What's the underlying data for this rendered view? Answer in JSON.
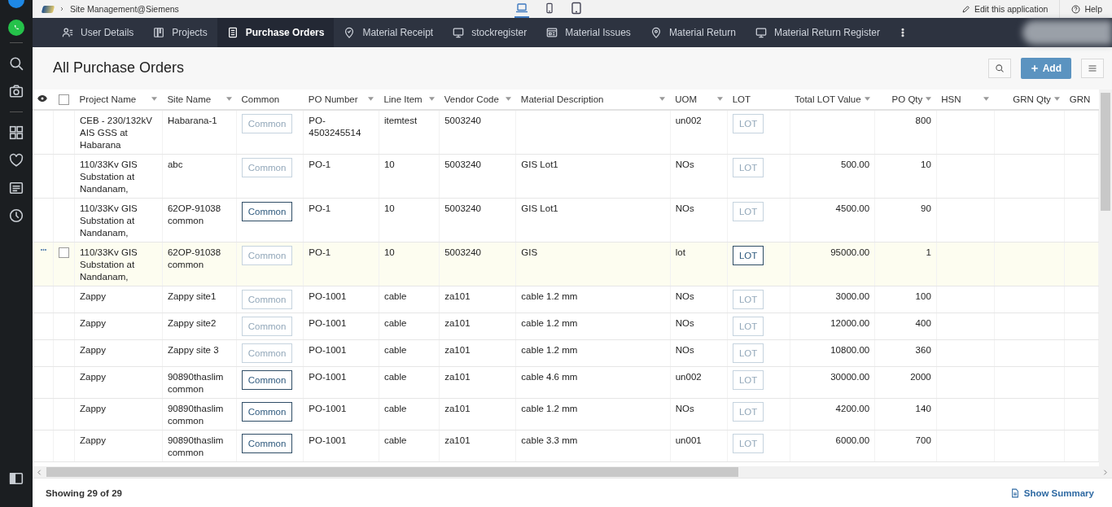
{
  "topbar": {
    "breadcrumb": "Site Management@Siemens",
    "devices": [
      {
        "kind": "laptop",
        "selected": true
      },
      {
        "kind": "phone",
        "selected": false
      },
      {
        "kind": "tablet",
        "selected": false
      }
    ],
    "edit_link": "Edit this application",
    "help_link": "Help"
  },
  "nav": {
    "tabs": [
      {
        "label": "User Details",
        "kind": "users",
        "selected": false
      },
      {
        "label": "Projects",
        "kind": "board",
        "selected": false
      },
      {
        "label": "Purchase Orders",
        "kind": "list",
        "selected": true
      },
      {
        "label": "Material Receipt",
        "kind": "pin-check",
        "selected": false
      },
      {
        "label": "stockregister",
        "kind": "monitor",
        "selected": false
      },
      {
        "label": "Material Issues",
        "kind": "form",
        "selected": false
      },
      {
        "label": "Material Return",
        "kind": "pin",
        "selected": false
      },
      {
        "label": "Material Return Register",
        "kind": "monitor",
        "selected": false
      }
    ]
  },
  "page": {
    "title": "All Purchase Orders",
    "add_button": "Add"
  },
  "table": {
    "select_all_checked": false,
    "columns": [
      {
        "label": "Project Name",
        "kind": "text",
        "sortable": true
      },
      {
        "label": "Site Name",
        "kind": "text",
        "sortable": true
      },
      {
        "label": "Common",
        "kind": "button",
        "sortable": false
      },
      {
        "label": "PO Number",
        "kind": "text",
        "sortable": true
      },
      {
        "label": "Line Item",
        "kind": "text",
        "sortable": true
      },
      {
        "label": "Vendor Code",
        "kind": "text",
        "sortable": true
      },
      {
        "label": "Material Description",
        "kind": "text",
        "sortable": true
      },
      {
        "label": "UOM",
        "kind": "text",
        "sortable": true
      },
      {
        "label": "LOT",
        "kind": "button",
        "sortable": false
      },
      {
        "label": "Total LOT Value",
        "kind": "number",
        "sortable": true
      },
      {
        "label": "PO Qty",
        "kind": "number",
        "sortable": true
      },
      {
        "label": "HSN",
        "kind": "text",
        "sortable": true
      },
      {
        "label": "GRN Qty",
        "kind": "number",
        "sortable": true
      },
      {
        "label": "GRN",
        "kind": "text",
        "sortable": false
      }
    ],
    "rows": [
      {
        "highlighted": false,
        "cells": [
          "CEB - 230/132kV AIS GSS at Habarana",
          "Habarana-1",
          {
            "label": "Common",
            "disabled": true
          },
          "PO-4503245514",
          "itemtest",
          "5003240",
          null,
          "un002",
          {
            "label": "LOT",
            "disabled": true
          },
          null,
          "800",
          null,
          null,
          null
        ]
      },
      {
        "highlighted": false,
        "cells": [
          "110/33Kv GIS Substation at Nandanam,",
          "abc",
          {
            "label": "Common",
            "disabled": true
          },
          "PO-1",
          "10",
          "5003240",
          "GIS Lot1",
          "NOs",
          {
            "label": "LOT",
            "disabled": true
          },
          "500.00",
          "10",
          null,
          null,
          null
        ]
      },
      {
        "highlighted": false,
        "cells": [
          "110/33Kv GIS Substation at Nandanam,",
          "62OP-91038 common",
          {
            "label": "Common",
            "disabled": false
          },
          "PO-1",
          "10",
          "5003240",
          "GIS Lot1",
          "NOs",
          {
            "label": "LOT",
            "disabled": true
          },
          "4500.00",
          "90",
          null,
          null,
          null
        ]
      },
      {
        "highlighted": true,
        "cells": [
          "110/33Kv GIS Substation at Nandanam,",
          "62OP-91038 common",
          {
            "label": "Common",
            "disabled": true
          },
          "PO-1",
          "10",
          "5003240",
          "GIS",
          "lot",
          {
            "label": "LOT",
            "disabled": false
          },
          "95000.00",
          "1",
          null,
          null,
          null
        ]
      },
      {
        "highlighted": false,
        "cells": [
          "Zappy",
          "Zappy site1",
          {
            "label": "Common",
            "disabled": true
          },
          "PO-1001",
          "cable",
          "za101",
          "cable 1.2 mm",
          "NOs",
          {
            "label": "LOT",
            "disabled": true
          },
          "3000.00",
          "100",
          null,
          null,
          null
        ]
      },
      {
        "highlighted": false,
        "cells": [
          "Zappy",
          "Zappy site2",
          {
            "label": "Common",
            "disabled": true
          },
          "PO-1001",
          "cable",
          "za101",
          "cable 1.2 mm",
          "NOs",
          {
            "label": "LOT",
            "disabled": true
          },
          "12000.00",
          "400",
          null,
          null,
          null
        ]
      },
      {
        "highlighted": false,
        "cells": [
          "Zappy",
          "Zappy site 3",
          {
            "label": "Common",
            "disabled": true
          },
          "PO-1001",
          "cable",
          "za101",
          "cable 1.2 mm",
          "NOs",
          {
            "label": "LOT",
            "disabled": true
          },
          "10800.00",
          "360",
          null,
          null,
          null
        ]
      },
      {
        "highlighted": false,
        "cells": [
          "Zappy",
          "90890thaslim common",
          {
            "label": "Common",
            "disabled": false
          },
          "PO-1001",
          "cable",
          "za101",
          "cable 4.6 mm",
          "un002",
          {
            "label": "LOT",
            "disabled": true
          },
          "30000.00",
          "2000",
          null,
          null,
          null
        ]
      },
      {
        "highlighted": false,
        "cells": [
          "Zappy",
          "90890thaslim common",
          {
            "label": "Common",
            "disabled": false
          },
          "PO-1001",
          "cable",
          "za101",
          "cable 1.2 mm",
          "NOs",
          {
            "label": "LOT",
            "disabled": true
          },
          "4200.00",
          "140",
          null,
          null,
          null
        ]
      },
      {
        "highlighted": false,
        "cells": [
          "Zappy",
          "90890thaslim common",
          {
            "label": "Common",
            "disabled": false
          },
          "PO-1001",
          "cable",
          "za101",
          "cable 3.3 mm",
          "un001",
          {
            "label": "LOT",
            "disabled": true
          },
          "6000.00",
          "700",
          null,
          null,
          null
        ]
      }
    ]
  },
  "footer": {
    "count": "Showing 29 of 29",
    "summary_link": "Show Summary"
  }
}
